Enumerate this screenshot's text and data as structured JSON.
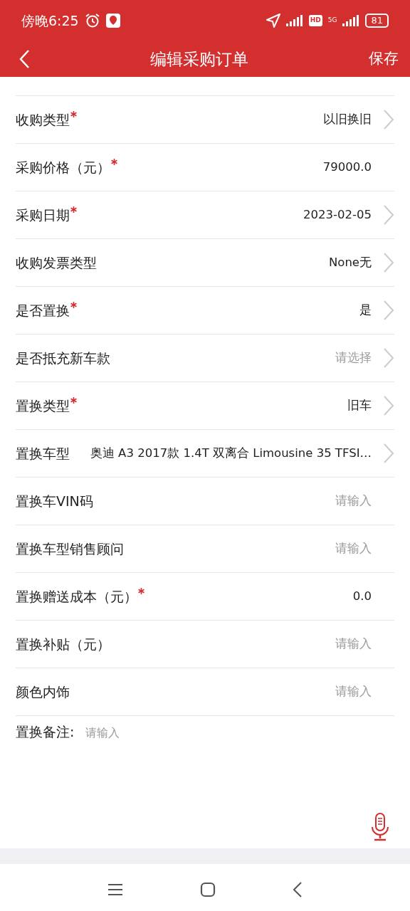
{
  "status_bar": {
    "time": "傍晚6:25",
    "battery": "81",
    "network": "5G",
    "hd": "HD"
  },
  "header": {
    "title": "编辑采购订单",
    "action": "保存"
  },
  "fields": [
    {
      "label": "收购类型",
      "required": true,
      "kind": "select",
      "value": "以旧换旧"
    },
    {
      "label": "采购价格（元）",
      "required": true,
      "kind": "input",
      "value": "79000.0"
    },
    {
      "label": "采购日期",
      "required": true,
      "kind": "select",
      "value": "2023-02-05"
    },
    {
      "label": "收购发票类型",
      "required": false,
      "kind": "select",
      "value": "None无"
    },
    {
      "label": "是否置换",
      "required": true,
      "kind": "select",
      "value": "是"
    },
    {
      "label": "是否抵充新车款",
      "required": false,
      "kind": "select",
      "placeholder": "请选择"
    },
    {
      "label": "置换类型",
      "required": true,
      "kind": "select",
      "value": "旧车"
    },
    {
      "label": "置换车型",
      "required": false,
      "kind": "select",
      "value": "奥迪 A3 2017款 1.4T 双离合 Limousine 35 TFSI…"
    },
    {
      "label": "置换车VIN码",
      "required": false,
      "kind": "input",
      "placeholder": "请输入"
    },
    {
      "label": "置换车型销售顾问",
      "required": false,
      "kind": "input",
      "placeholder": "请输入"
    },
    {
      "label": "置换赠送成本（元）",
      "required": true,
      "kind": "input",
      "value": "0.0"
    },
    {
      "label": "置换补贴（元）",
      "required": false,
      "kind": "input",
      "placeholder": "请输入"
    },
    {
      "label": "颜色内饰",
      "required": false,
      "kind": "input",
      "placeholder": "请输入"
    }
  ],
  "remark": {
    "label": "置换备注:",
    "placeholder": "请输入"
  }
}
